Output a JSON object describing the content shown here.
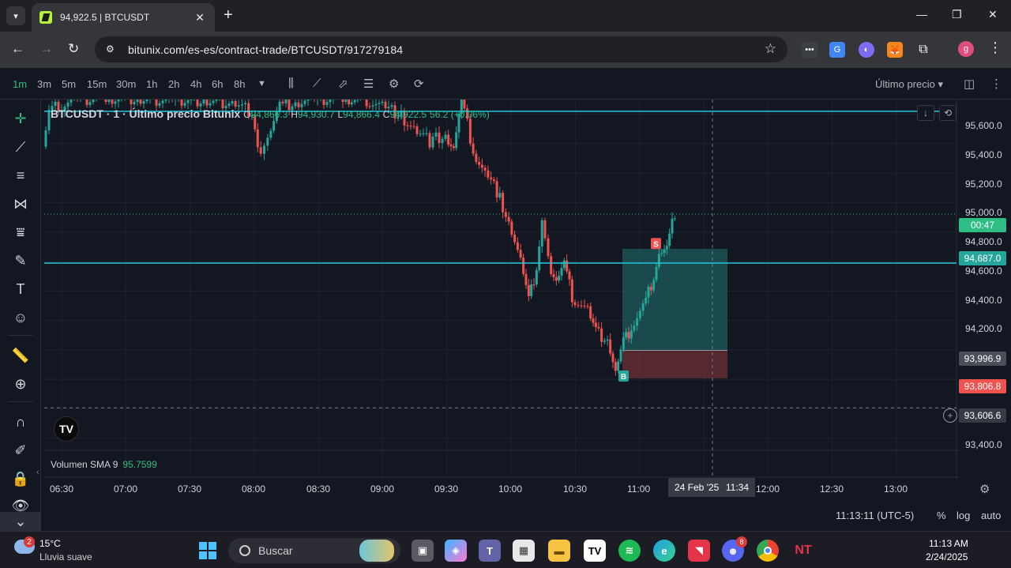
{
  "browser": {
    "tab_title": "94,922.5 | BTCUSDT",
    "url": "bitunix.com/es-es/contract-trade/BTCUSDT/917279184",
    "tab_close": "✕",
    "new_tab": "+",
    "profile_initial": "g"
  },
  "toolbar": {
    "timeframes": [
      "1m",
      "3m",
      "5m",
      "15m",
      "30m",
      "1h",
      "2h",
      "4h",
      "6h",
      "8h"
    ],
    "active_timeframe": "1m",
    "price_mode": "Último precio ▾"
  },
  "legend": {
    "title": "BTCUSDT · 1 · Último precio Bitunix",
    "o_key": "O",
    "o_val": "94,866.3",
    "h_key": "H",
    "h_val": "94,930.7",
    "l_key": "L",
    "l_val": "94,866.4",
    "c_key": "C",
    "c_val": "94,922.5",
    "change": "56.2 (+0.06%)"
  },
  "price_axis": {
    "labels": [
      "95,600.0",
      "95,400.0",
      "95,200.0",
      "95,000.0",
      "94,800.0",
      "94,600.0",
      "94,400.0",
      "94,200.0",
      "94,000.0",
      "93,800.0",
      "93,600.0",
      "93,400.0"
    ],
    "countdown": "00:47",
    "tag_entry": "94,687.0",
    "tag_stop_top": "93,996.9",
    "tag_stop_bottom": "93,806.8",
    "tag_crosshair": "93,606.6",
    "colors": {
      "up": "#26a69a",
      "down": "#ef5350",
      "hline": "#26c6da",
      "accent": "#2ebd85"
    }
  },
  "time_axis": {
    "labels": [
      "06:30",
      "07:00",
      "07:30",
      "08:00",
      "08:30",
      "09:00",
      "09:30",
      "10:00",
      "10:30",
      "11:00",
      "12:00",
      "12:30",
      "13:00"
    ],
    "crosshair_date": "24 Feb '25",
    "crosshair_time": "11:34"
  },
  "volume": {
    "label": "Volumen SMA 9",
    "value": "95.7599"
  },
  "bottom_bar": {
    "time": "11:13:11 (UTC-5)",
    "percent": "%",
    "log": "log",
    "auto": "auto"
  },
  "markers": {
    "buy": "B",
    "sell": "S"
  },
  "taskbar": {
    "weather_badge": "2",
    "temperature": "15°C",
    "weather_desc": "Lluvia suave",
    "search_placeholder": "Buscar",
    "clock_time": "11:13 AM",
    "clock_date": "2/24/2025",
    "discord_badge": "8"
  }
}
